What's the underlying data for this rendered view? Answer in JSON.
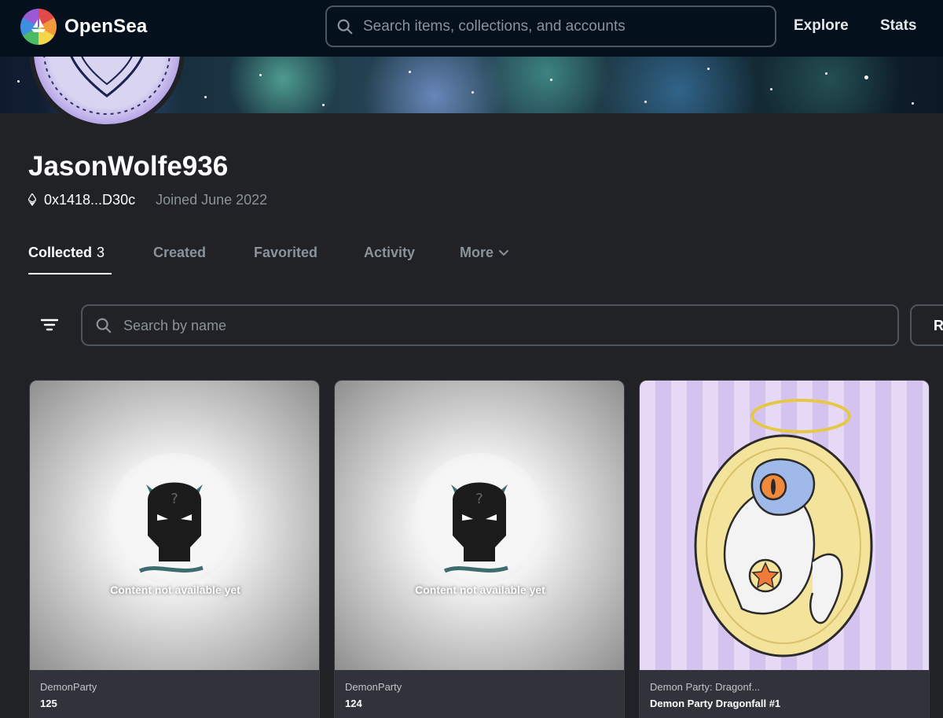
{
  "header": {
    "brand": "OpenSea",
    "search_placeholder": "Search items, collections, and accounts",
    "nav": [
      "Explore",
      "Stats"
    ]
  },
  "profile": {
    "username": "JasonWolfe936",
    "address": "0x1418...D30c",
    "joined": "Joined June 2022"
  },
  "tabs": [
    {
      "label": "Collected",
      "count": "3",
      "active": true
    },
    {
      "label": "Created"
    },
    {
      "label": "Favorited"
    },
    {
      "label": "Activity"
    },
    {
      "label": "More"
    }
  ],
  "toolbar": {
    "search_placeholder": "Search by name",
    "side_button_label": "R"
  },
  "cards": [
    {
      "collection": "DemonParty",
      "name": "125",
      "media_text": "Content not available yet"
    },
    {
      "collection": "DemonParty",
      "name": "124",
      "media_text": "Content not available yet"
    },
    {
      "collection": "Demon Party: Dragonf...",
      "name": "Demon Party Dragonfall #1"
    }
  ],
  "colors": {
    "nav_bg": "#04111d",
    "page_bg": "#202225",
    "card_bg": "#303339",
    "muted_text": "#8a939b",
    "border": "#4c5560"
  }
}
